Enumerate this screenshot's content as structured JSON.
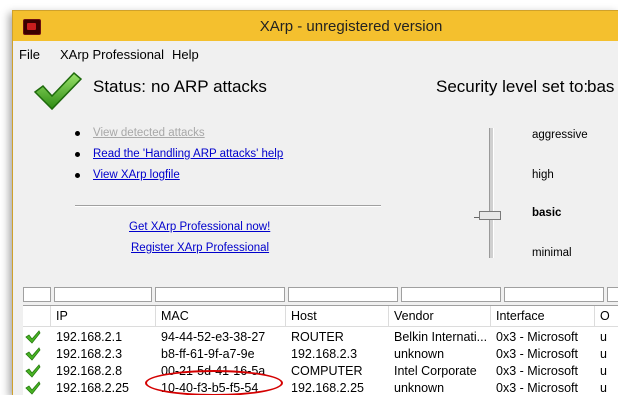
{
  "window": {
    "title": "XArp - unregistered version"
  },
  "menu": {
    "file": "File",
    "pro": "XArp Professional",
    "help": "Help"
  },
  "status": {
    "label": "Status:",
    "value": "no ARP attacks",
    "security_label": "Security level set to:",
    "security_value": "bas"
  },
  "links": {
    "view_attacks": "View detected attacks",
    "handling_help": "Read the 'Handling ARP attacks' help",
    "view_log": "View XArp logfile",
    "get_pro": "Get XArp Professional now!",
    "register": "Register XArp Professional"
  },
  "levels": {
    "aggressive": "aggressive",
    "high": "high",
    "basic": "basic",
    "minimal": "minimal",
    "selected": "basic"
  },
  "table": {
    "headers": [
      "IP",
      "MAC",
      "Host",
      "Vendor",
      "Interface",
      "O"
    ],
    "rows": [
      [
        "192.168.2.1",
        "94-44-52-e3-38-27",
        "ROUTER",
        "Belkin Internati...",
        "0x3 - Microsoft",
        "u"
      ],
      [
        "192.168.2.3",
        "b8-ff-61-9f-a7-9e",
        "192.168.2.3",
        "unknown",
        "0x3 - Microsoft",
        "u"
      ],
      [
        "192.168.2.8",
        "00-21-5d-41-16-5a",
        "COMPUTER",
        "Intel Corporate",
        "0x3 - Microsoft",
        "u"
      ],
      [
        "192.168.2.25",
        "10-40-f3-b5-f5-54",
        "192.168.2.25",
        "unknown",
        "0x3 - Microsoft",
        "u"
      ]
    ]
  },
  "colors": {
    "titlebar": "#f4c02e",
    "link": "#0000cc",
    "highlight": "#d40000",
    "check": "#3a9a1a"
  }
}
